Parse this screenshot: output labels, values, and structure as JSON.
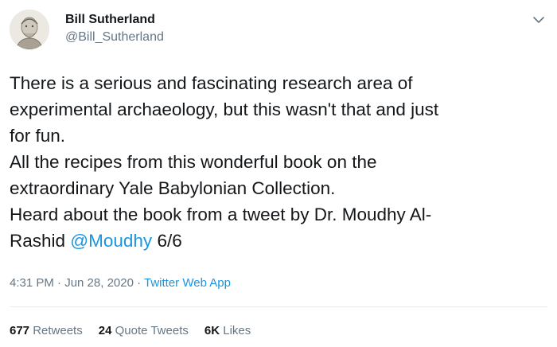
{
  "author": {
    "display_name": "Bill Sutherland",
    "handle": "@Bill_Sutherland"
  },
  "tweet": {
    "lines": [
      [
        {
          "text": "There is a serious and fascinating research area of"
        }
      ],
      [
        {
          "text": "experimental archaeology, but this wasn't that and just"
        }
      ],
      [
        {
          "text": "for fun."
        }
      ],
      [
        {
          "text": "All the recipes from this wonderful book on the"
        }
      ],
      [
        {
          "text": "extraordinary Yale Babylonian Collection."
        }
      ],
      [
        {
          "text": "Heard about the book from a tweet by Dr. Moudhy Al-"
        }
      ],
      [
        {
          "text": "Rashid "
        },
        {
          "text": "@Moudhy",
          "mention": true
        },
        {
          "text": " 6/6"
        }
      ]
    ]
  },
  "meta": {
    "time": "4:31 PM · Jun 28, 2020 · ",
    "app": "Twitter Web App"
  },
  "stats": [
    {
      "count": "677",
      "label": "Retweets"
    },
    {
      "count": "24",
      "label": "Quote Tweets"
    },
    {
      "count": "6K",
      "label": "Likes"
    }
  ],
  "icons": {
    "more": "chevron-down-icon",
    "avatar": "avatar-sketch"
  },
  "colors": {
    "link": "#1b95e0",
    "secondary": "#657786",
    "text": "#14171a"
  }
}
